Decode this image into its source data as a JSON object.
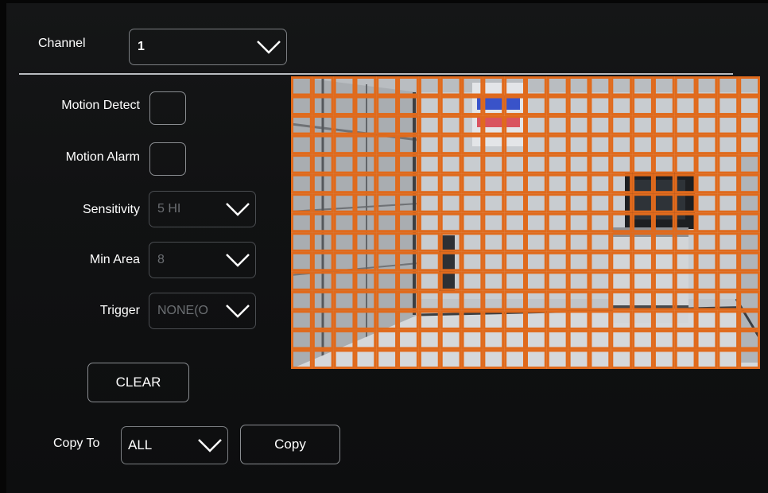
{
  "channel": {
    "label": "Channel",
    "value": "1"
  },
  "motion_detect": {
    "label": "Motion Detect",
    "checked": false
  },
  "motion_alarm": {
    "label": "Motion Alarm",
    "checked": false
  },
  "sensitivity": {
    "label": "Sensitivity",
    "value": "5 HI"
  },
  "min_area": {
    "label": "Min Area",
    "value": "8"
  },
  "trigger": {
    "label": "Trigger",
    "value": "NONE(O"
  },
  "clear_button": {
    "label": "CLEAR"
  },
  "copy_to": {
    "label": "Copy To",
    "value": "ALL",
    "button_label": "Copy"
  },
  "motion_grid": {
    "columns": 22,
    "rows": 15,
    "all_cells_selected": true,
    "cell_color": "#e06a1c"
  },
  "colors": {
    "background": "#111213",
    "accent": "#e06a1c",
    "text": "#ffffff",
    "disabled_text": "#6b6e72"
  }
}
